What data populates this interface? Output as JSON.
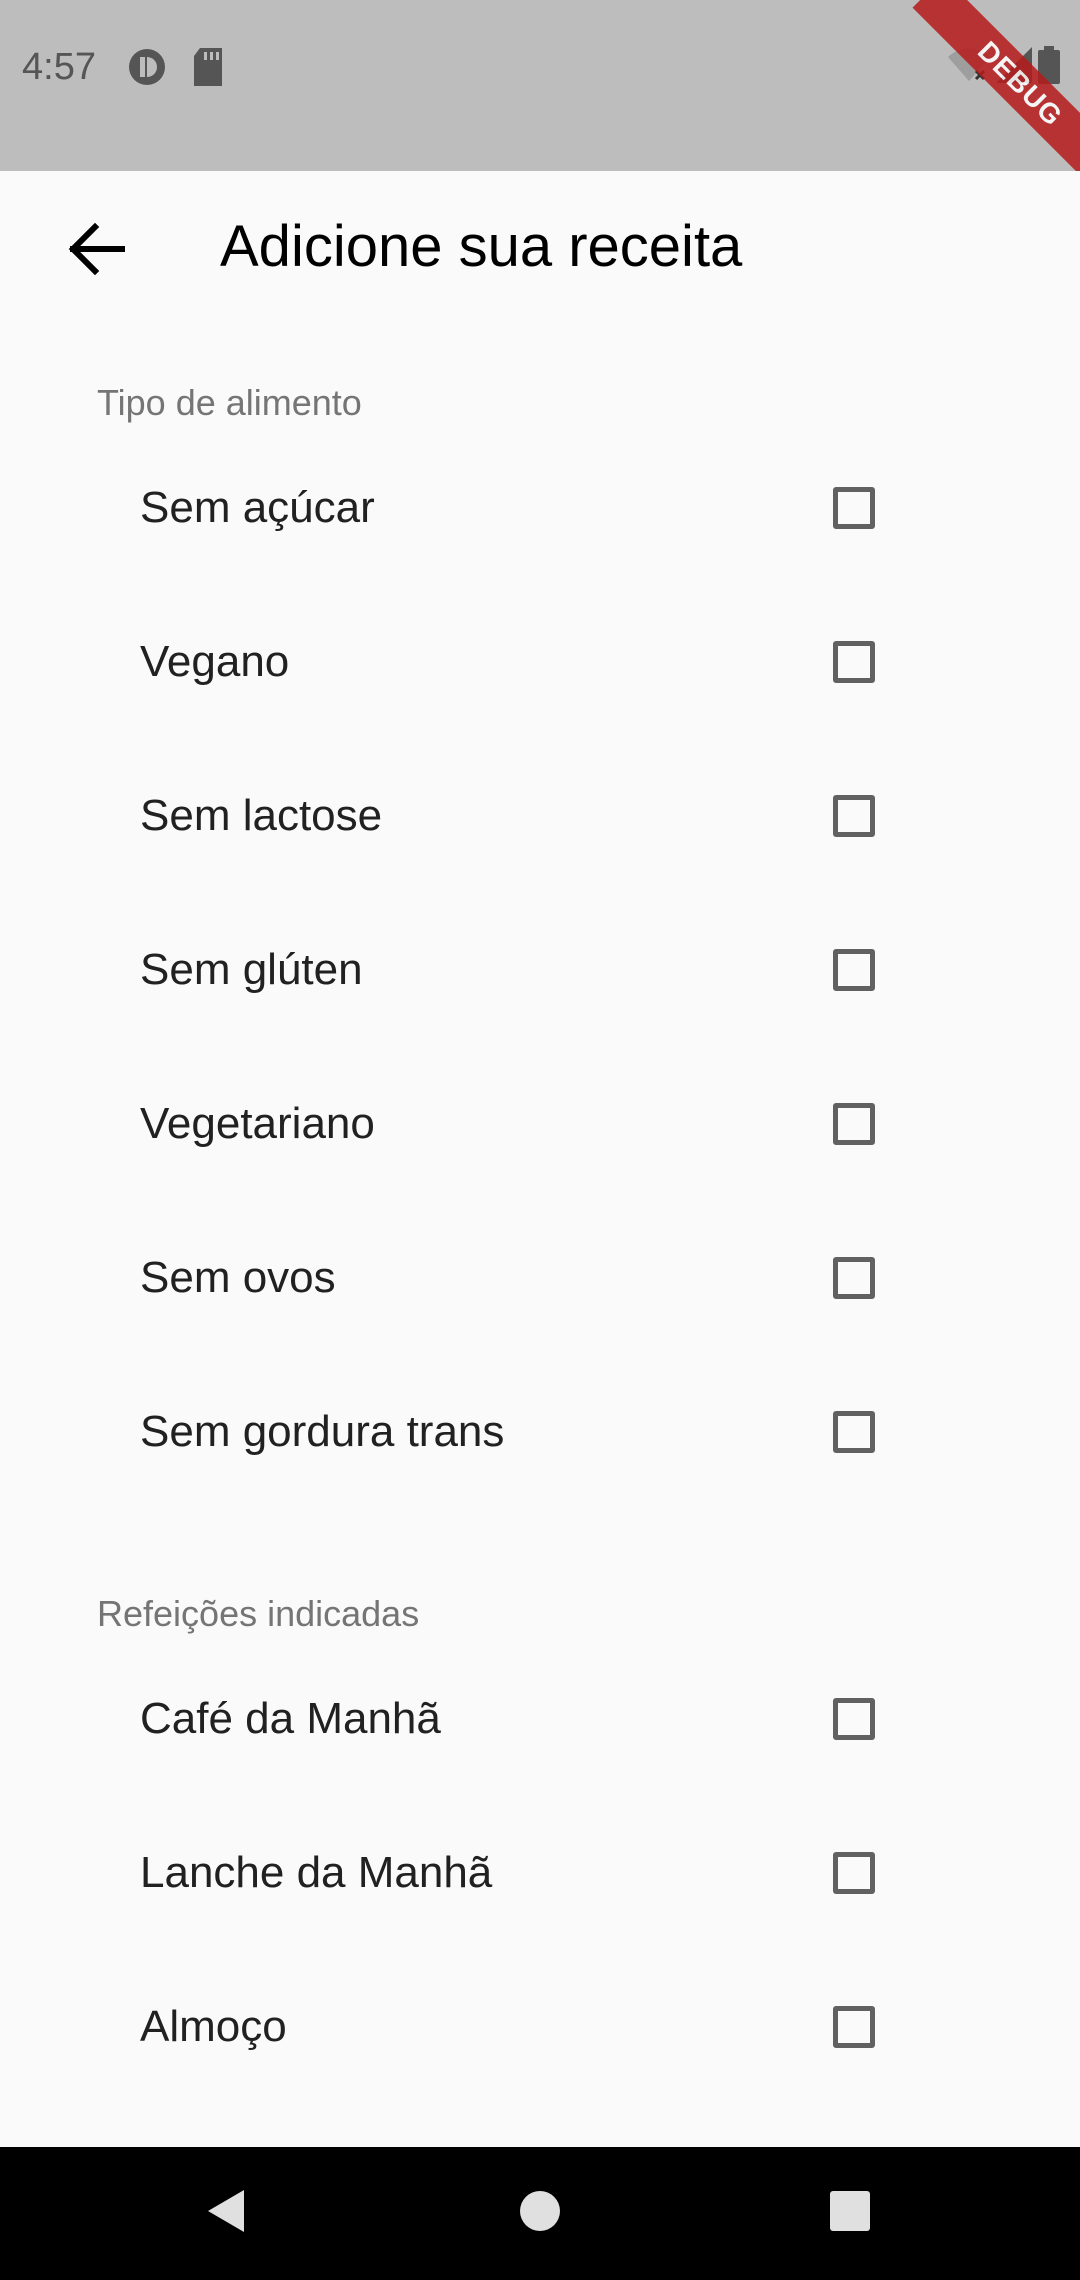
{
  "status_bar": {
    "time": "4:57",
    "debug_label": "DEBUG"
  },
  "app_bar": {
    "title": "Adicione sua receita"
  },
  "sections": [
    {
      "label": "Tipo de alimento",
      "options": [
        {
          "label": "Sem açúcar",
          "checked": false
        },
        {
          "label": "Vegano",
          "checked": false
        },
        {
          "label": "Sem lactose",
          "checked": false
        },
        {
          "label": "Sem glúten",
          "checked": false
        },
        {
          "label": "Vegetariano",
          "checked": false
        },
        {
          "label": "Sem ovos",
          "checked": false
        },
        {
          "label": "Sem gordura trans",
          "checked": false
        }
      ]
    },
    {
      "label": "Refeições indicadas",
      "options": [
        {
          "label": "Café da Manhã",
          "checked": false
        },
        {
          "label": "Lanche da Manhã",
          "checked": false
        },
        {
          "label": "Almoço",
          "checked": false
        }
      ]
    }
  ],
  "nav_bar": {
    "buttons": [
      "back-icon",
      "home-icon",
      "recents-icon"
    ]
  },
  "colors": {
    "status_bar_bg": "#bdbdbd",
    "background": "#fafafa",
    "section_label": "#757575",
    "checkbox_border": "#616161",
    "debug_banner": "#b71c1c"
  }
}
